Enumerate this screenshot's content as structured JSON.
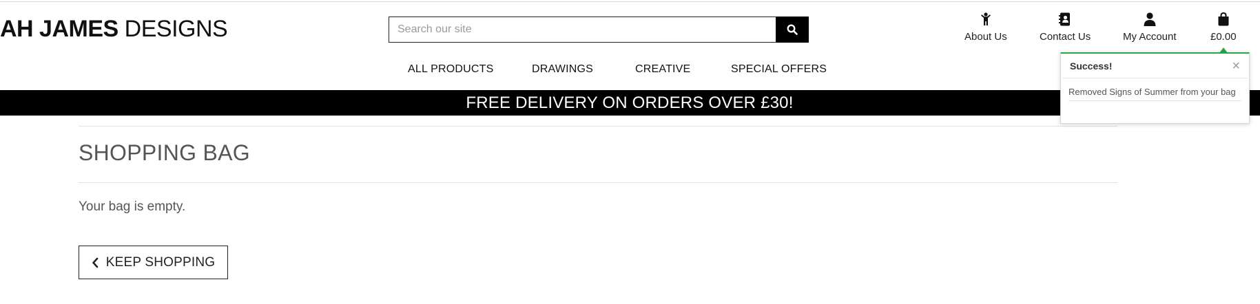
{
  "brand": {
    "bold": "AH JAMES",
    "light": "DESIGNS"
  },
  "search": {
    "placeholder": "Search our site",
    "value": ""
  },
  "nav_icons": [
    {
      "icon": "person-icon",
      "label": "About Us"
    },
    {
      "icon": "address-book-icon",
      "label": "Contact Us"
    },
    {
      "icon": "user-icon",
      "label": "My Account"
    },
    {
      "icon": "shopping-bag-icon",
      "label": "£0.00"
    }
  ],
  "main_nav": [
    "ALL PRODUCTS",
    "DRAWINGS",
    "CREATIVE",
    "SPECIAL OFFERS"
  ],
  "banner": "FREE DELIVERY ON ORDERS OVER £30!",
  "page": {
    "title": "SHOPPING BAG",
    "empty_message": "Your bag is empty.",
    "keep_shopping": "KEEP SHOPPING"
  },
  "toast": {
    "title": "Success!",
    "close": "×",
    "message": "Removed Signs of Summer from your bag",
    "accent": "#28a745"
  },
  "colors": {
    "banner_bg": "#000000",
    "banner_text": "#ffffff"
  }
}
